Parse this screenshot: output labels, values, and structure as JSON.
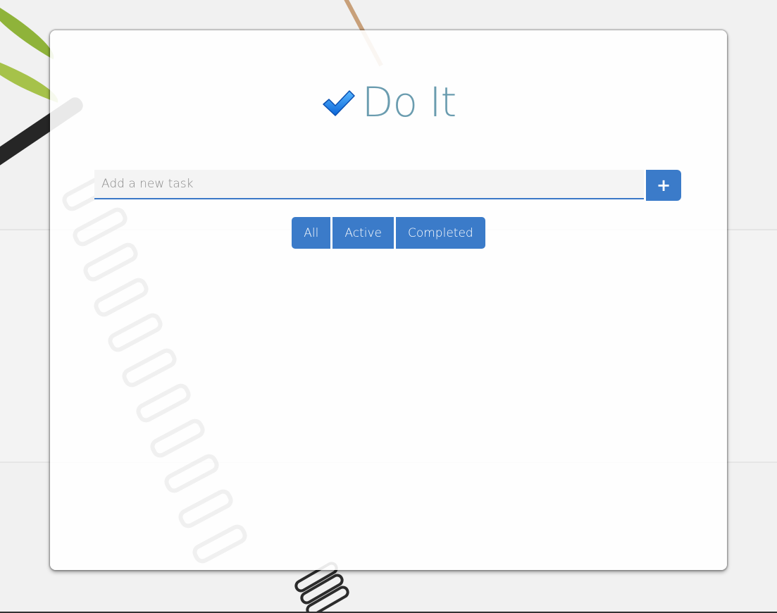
{
  "app": {
    "title": "Do It"
  },
  "new_task": {
    "placeholder": "Add a new task",
    "value": "",
    "add_label": "+"
  },
  "filters": [
    {
      "label": "All"
    },
    {
      "label": "Active"
    },
    {
      "label": "Completed"
    }
  ],
  "colors": {
    "accent": "#3b7bc9",
    "title": "#6a9caf"
  },
  "icons": {
    "logo": "checkmark-icon",
    "add": "plus-icon"
  }
}
